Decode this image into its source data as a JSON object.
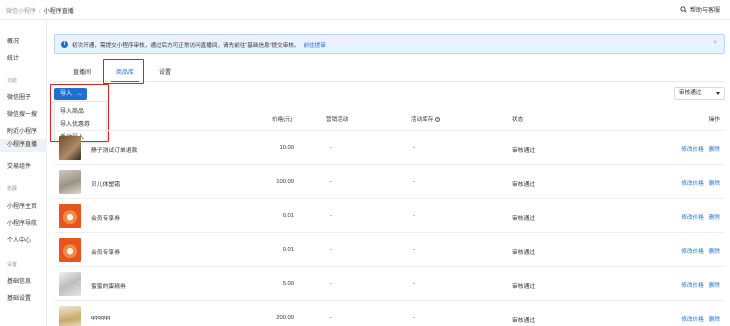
{
  "header": {
    "crumb_root": "微信小程序",
    "crumb_sep": "/",
    "crumb_current": "小程序直播",
    "help_label": "帮助与客服"
  },
  "sidebar": {
    "top_items": [
      "概况",
      "统计"
    ],
    "groups": [
      {
        "label": "功能",
        "items": [
          "微信圈子",
          "微信搜一搜",
          "附近小程序",
          "小程序直播",
          "交易组件"
        ]
      },
      {
        "label": "拓展",
        "items": [
          "小程序主页",
          "小程序导航",
          "个人中心"
        ]
      },
      {
        "label": "设置",
        "items": [
          "基础信息",
          "基础设置"
        ]
      }
    ],
    "active_item": "小程序直播"
  },
  "notice": {
    "text": "初次开通，需提交小程序审核，通过后方可正常访问直播间，请先前往“基础信息”提交审核。",
    "link": "前往提审",
    "close": "×"
  },
  "tabs": [
    "直播间",
    "商品库",
    "设置"
  ],
  "active_tab": "商品库",
  "toolbar": {
    "import_label": "导入",
    "import_menu": [
      "导入商品",
      "导入优惠券",
      "手动导入"
    ],
    "status_filter": "审核通过"
  },
  "table": {
    "columns": [
      "价格(元)",
      "营销活动",
      "活动库存",
      "状态",
      "操作"
    ],
    "rows": [
      {
        "name": "静子测试订单退款",
        "price": "10.00",
        "promo": "-",
        "stock": "-",
        "status": "审核通过",
        "thumb_color": "#8a6a4a"
      },
      {
        "name": "贝儿体塑霜",
        "price": "100.00",
        "promo": "-",
        "stock": "-",
        "status": "审核通过",
        "thumb_color": "#b7b3a8"
      },
      {
        "name": "会员专享券",
        "price": "0.01",
        "promo": "-",
        "stock": "-",
        "status": "审核通过",
        "thumb_color": "#ef6a2c"
      },
      {
        "name": "会员专享券",
        "price": "0.01",
        "promo": "-",
        "stock": "-",
        "status": "审核通过",
        "thumb_color": "#ef6a2c"
      },
      {
        "name": "蜜蜜的蛋糕券",
        "price": "5.00",
        "promo": "-",
        "stock": "-",
        "status": "审核通过",
        "thumb_color": "#d8d8d8"
      },
      {
        "name": "qqqqqq",
        "price": "200.00",
        "promo": "-",
        "stock": "-",
        "status": "审核通过",
        "thumb_color": "#c9b690"
      }
    ],
    "actions": [
      "修改价格",
      "删除"
    ]
  },
  "colors": {
    "accent": "#1f6fd1",
    "highlight": "#e02020",
    "notice_bg": "#e9f3ff"
  }
}
